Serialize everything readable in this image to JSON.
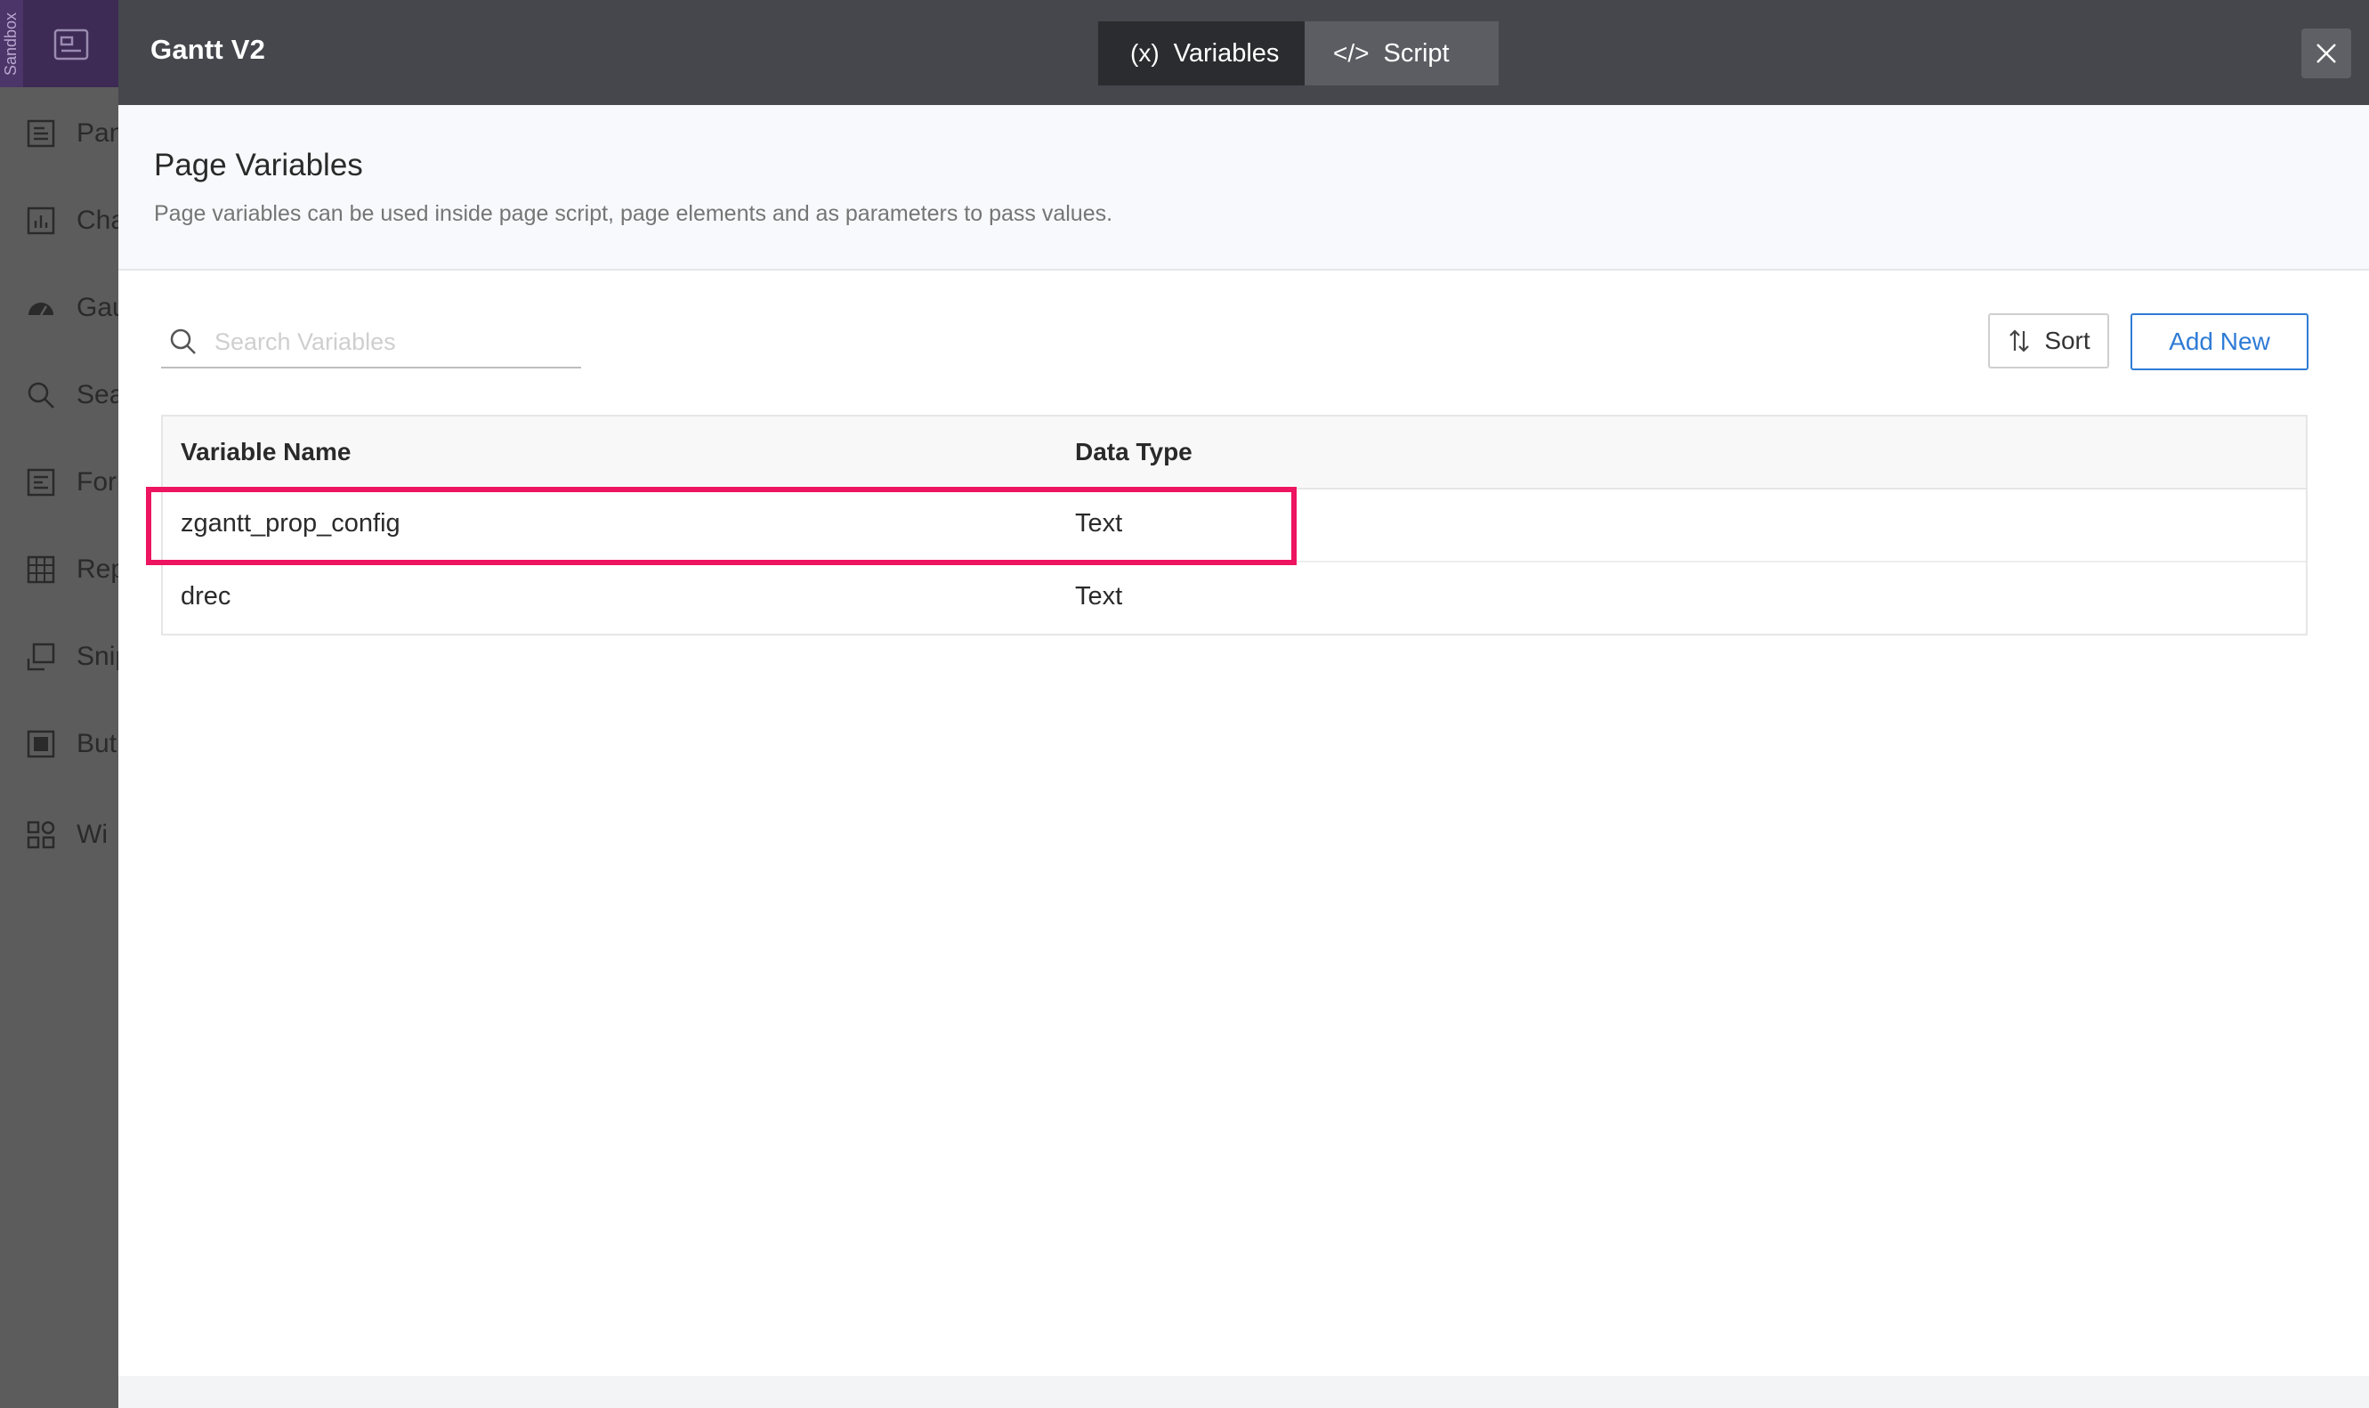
{
  "sidebar": {
    "sandbox_label": "Sandbox",
    "items": [
      {
        "label": "Pan",
        "icon": "page-icon"
      },
      {
        "label": "Cha",
        "icon": "chart-icon"
      },
      {
        "label": "Gau",
        "icon": "gauge-icon"
      },
      {
        "label": "Sea",
        "icon": "search-icon"
      },
      {
        "label": "For",
        "icon": "form-icon"
      },
      {
        "label": "Rep",
        "icon": "grid-icon"
      },
      {
        "label": "Snip",
        "icon": "snippet-icon"
      },
      {
        "label": "But",
        "icon": "button-icon"
      },
      {
        "label": "Wi",
        "icon": "widget-icon"
      }
    ]
  },
  "dialog": {
    "title": "Gantt V2",
    "tabs": [
      {
        "label": "Variables",
        "icon": "(x)",
        "active": true
      },
      {
        "label": "Script",
        "icon": "</>",
        "active": false
      }
    ],
    "section": {
      "title": "Page Variables",
      "description": "Page variables can be used inside page script, page elements and as parameters to pass values."
    },
    "search": {
      "placeholder": "Search Variables",
      "value": ""
    },
    "sort_label": "Sort",
    "add_label": "Add New",
    "table": {
      "headers": {
        "name": "Variable Name",
        "type": "Data Type"
      },
      "rows": [
        {
          "name": "zgantt_prop_config",
          "type": "Text"
        },
        {
          "name": "drec",
          "type": "Text"
        }
      ]
    }
  },
  "colors": {
    "header_bg": "#45474c",
    "accent_blue": "#2f7bd6",
    "highlight": "#ed1460"
  }
}
